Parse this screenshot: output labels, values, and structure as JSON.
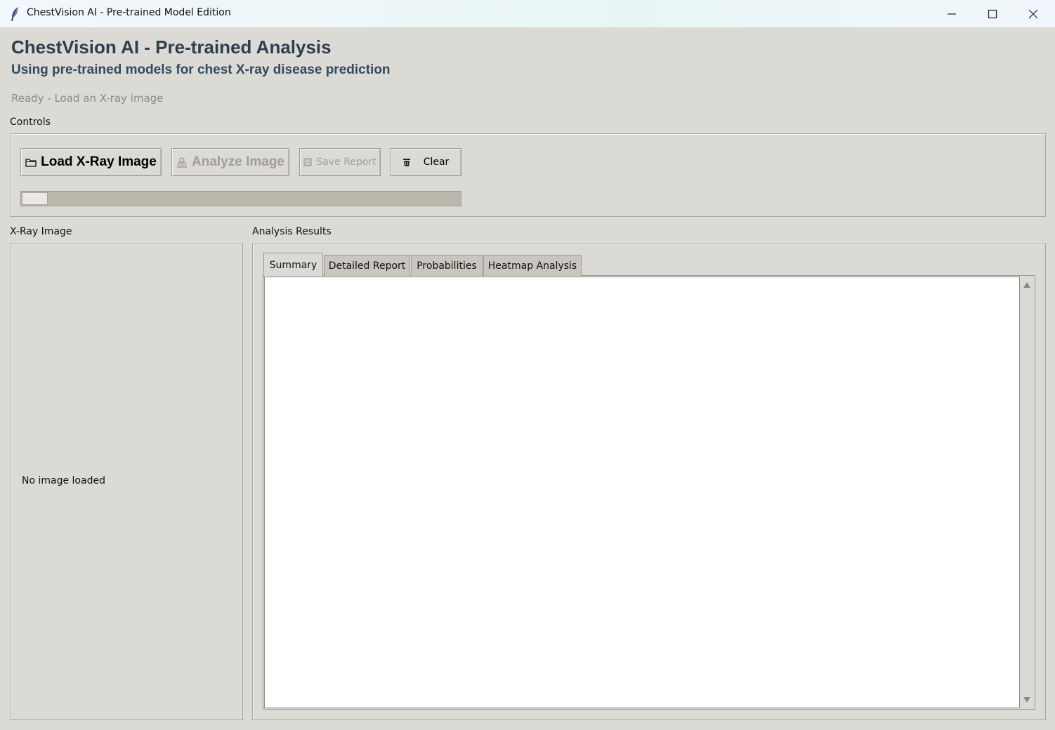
{
  "window": {
    "title": "ChestVision AI - Pre-trained Model Edition",
    "minimize_icon": "minimize-icon",
    "maximize_icon": "maximize-icon",
    "close_icon": "close-icon"
  },
  "header": {
    "title": "ChestVision AI - Pre-trained Analysis",
    "subtitle": "Using pre-trained models for chest X-ray disease prediction"
  },
  "status": "Ready - Load an X-ray image",
  "controls": {
    "label": "Controls",
    "load_button": {
      "label": "Load X-Ray Image",
      "icon": "folder-icon",
      "enabled": true
    },
    "analyze_button": {
      "label": "Analyze Image",
      "icon": "scientist-icon",
      "enabled": false
    },
    "save_button": {
      "label": "Save Report",
      "icon": "floppy-disk-icon",
      "enabled": false
    },
    "clear_button": {
      "label": "Clear",
      "icon": "trash-icon",
      "enabled": true
    },
    "progress": {
      "value_percent": 6
    }
  },
  "xray_panel": {
    "label": "X-Ray Image",
    "placeholder": "No image loaded"
  },
  "results_panel": {
    "label": "Analysis Results",
    "tabs": [
      {
        "label": "Summary",
        "active": true
      },
      {
        "label": "Detailed Report",
        "active": false
      },
      {
        "label": "Probabilities",
        "active": false
      },
      {
        "label": "Heatmap Analysis",
        "active": false
      }
    ],
    "summary_text": ""
  },
  "colors": {
    "background": "#dcdad5",
    "title": "#2d3e50",
    "subtitle": "#34495e",
    "status": "#8a8a8a",
    "disabled_text": "#a19e98"
  }
}
